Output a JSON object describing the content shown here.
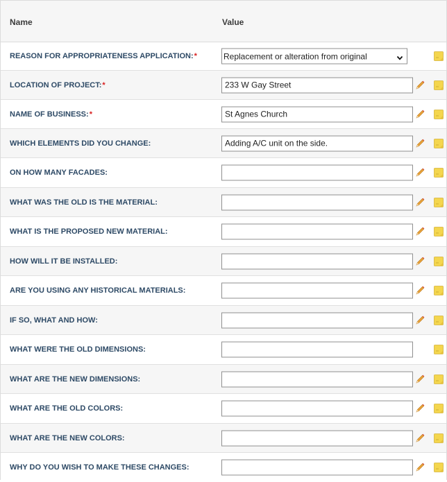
{
  "header": {
    "name_col": "Name",
    "value_col": "Value"
  },
  "colors": {
    "label": "#2e4a66",
    "required": "#d82020",
    "note": "#f4d64e",
    "pencil": "#e8a33a"
  },
  "rows": [
    {
      "label": "REASON FOR APPROPRIATENESS APPLICATION:",
      "required": true,
      "type": "select",
      "value": "Replacement or alteration from original",
      "pencil": false
    },
    {
      "label": "LOCATION OF PROJECT:",
      "required": true,
      "type": "text",
      "value": "233 W Gay Street",
      "pencil": true
    },
    {
      "label": "NAME OF BUSINESS:",
      "required": true,
      "type": "text",
      "value": "St Agnes Church",
      "pencil": true
    },
    {
      "label": "WHICH ELEMENTS DID YOU CHANGE:",
      "required": false,
      "type": "text",
      "value": "Adding A/C unit on the side.",
      "pencil": true
    },
    {
      "label": "ON HOW MANY FACADES:",
      "required": false,
      "type": "text",
      "value": "",
      "pencil": true
    },
    {
      "label": "WHAT WAS THE OLD IS THE MATERIAL:",
      "required": false,
      "type": "text",
      "value": "",
      "pencil": true
    },
    {
      "label": "WHAT IS THE PROPOSED NEW MATERIAL:",
      "required": false,
      "type": "text",
      "value": "",
      "pencil": true
    },
    {
      "label": "HOW WILL IT BE INSTALLED:",
      "required": false,
      "type": "text",
      "value": "",
      "pencil": true
    },
    {
      "label": "ARE YOU USING ANY HISTORICAL MATERIALS:",
      "required": false,
      "type": "text",
      "value": "",
      "pencil": true
    },
    {
      "label": "IF SO, WHAT AND HOW:",
      "required": false,
      "type": "text",
      "value": "",
      "pencil": true
    },
    {
      "label": "WHAT WERE THE OLD DIMENSIONS:",
      "required": false,
      "type": "text",
      "value": "",
      "pencil": false
    },
    {
      "label": "WHAT ARE THE NEW DIMENSIONS:",
      "required": false,
      "type": "text",
      "value": "",
      "pencil": true
    },
    {
      "label": "WHAT ARE THE OLD COLORS:",
      "required": false,
      "type": "text",
      "value": "",
      "pencil": true
    },
    {
      "label": "WHAT ARE THE NEW COLORS:",
      "required": false,
      "type": "text",
      "value": "",
      "pencil": true
    },
    {
      "label": "WHY DO YOU WISH TO MAKE THESE CHANGES:",
      "required": false,
      "type": "text",
      "value": "",
      "pencil": true
    }
  ]
}
